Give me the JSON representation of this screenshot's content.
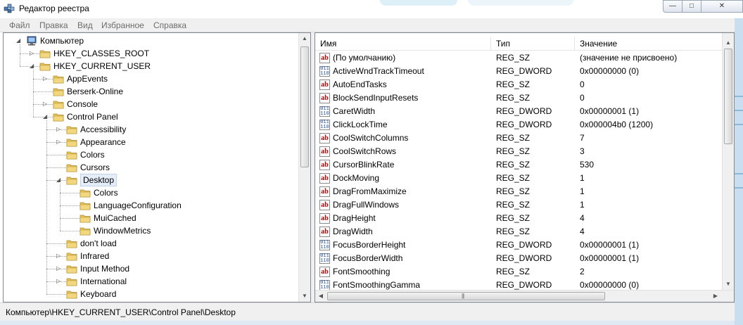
{
  "window": {
    "title": "Редактор реестра",
    "minimize_label": "—",
    "maximize_label": "□",
    "close_label": "✕"
  },
  "menu": [
    "Файл",
    "Правка",
    "Вид",
    "Избранное",
    "Справка"
  ],
  "tree": {
    "items": [
      {
        "label": "Компьютер",
        "level": 0,
        "expander": "collapse",
        "icon": "computer-icon"
      },
      {
        "label": "HKEY_CLASSES_ROOT",
        "level": 1,
        "expander": "expand"
      },
      {
        "label": "HKEY_CURRENT_USER",
        "level": 1,
        "expander": "collapse"
      },
      {
        "label": "AppEvents",
        "level": 2,
        "expander": "expand"
      },
      {
        "label": "Berserk-Online",
        "level": 2,
        "expander": "none"
      },
      {
        "label": "Console",
        "level": 2,
        "expander": "expand"
      },
      {
        "label": "Control Panel",
        "level": 2,
        "expander": "collapse"
      },
      {
        "label": "Accessibility",
        "level": 3,
        "expander": "expand"
      },
      {
        "label": "Appearance",
        "level": 3,
        "expander": "expand"
      },
      {
        "label": "Colors",
        "level": 3,
        "expander": "none"
      },
      {
        "label": "Cursors",
        "level": 3,
        "expander": "none"
      },
      {
        "label": "Desktop",
        "level": 3,
        "expander": "collapse",
        "selected": true
      },
      {
        "label": "Colors",
        "level": 4,
        "expander": "none"
      },
      {
        "label": "LanguageConfiguration",
        "level": 4,
        "expander": "none"
      },
      {
        "label": "MuiCached",
        "level": 4,
        "expander": "none"
      },
      {
        "label": "WindowMetrics",
        "level": 4,
        "expander": "none"
      },
      {
        "label": "don't load",
        "level": 3,
        "expander": "none"
      },
      {
        "label": "Infrared",
        "level": 3,
        "expander": "expand"
      },
      {
        "label": "Input Method",
        "level": 3,
        "expander": "expand"
      },
      {
        "label": "International",
        "level": 3,
        "expander": "expand"
      },
      {
        "label": "Keyboard",
        "level": 3,
        "expander": "none"
      }
    ]
  },
  "list": {
    "columns": [
      "Имя",
      "Тип",
      "Значение"
    ],
    "rows": [
      {
        "name": "(По умолчанию)",
        "type": "REG_SZ",
        "value": "(значение не присвоено)",
        "icon": "string-value-icon"
      },
      {
        "name": "ActiveWndTrackTimeout",
        "type": "REG_DWORD",
        "value": "0x00000000 (0)",
        "icon": "binary-value-icon"
      },
      {
        "name": "AutoEndTasks",
        "type": "REG_SZ",
        "value": "0",
        "icon": "string-value-icon"
      },
      {
        "name": "BlockSendInputResets",
        "type": "REG_SZ",
        "value": "0",
        "icon": "string-value-icon"
      },
      {
        "name": "CaretWidth",
        "type": "REG_DWORD",
        "value": "0x00000001 (1)",
        "icon": "binary-value-icon"
      },
      {
        "name": "ClickLockTime",
        "type": "REG_DWORD",
        "value": "0x000004b0 (1200)",
        "icon": "binary-value-icon"
      },
      {
        "name": "CoolSwitchColumns",
        "type": "REG_SZ",
        "value": "7",
        "icon": "string-value-icon"
      },
      {
        "name": "CoolSwitchRows",
        "type": "REG_SZ",
        "value": "3",
        "icon": "string-value-icon"
      },
      {
        "name": "CursorBlinkRate",
        "type": "REG_SZ",
        "value": "530",
        "icon": "string-value-icon"
      },
      {
        "name": "DockMoving",
        "type": "REG_SZ",
        "value": "1",
        "icon": "string-value-icon"
      },
      {
        "name": "DragFromMaximize",
        "type": "REG_SZ",
        "value": "1",
        "icon": "string-value-icon"
      },
      {
        "name": "DragFullWindows",
        "type": "REG_SZ",
        "value": "1",
        "icon": "string-value-icon"
      },
      {
        "name": "DragHeight",
        "type": "REG_SZ",
        "value": "4",
        "icon": "string-value-icon"
      },
      {
        "name": "DragWidth",
        "type": "REG_SZ",
        "value": "4",
        "icon": "string-value-icon"
      },
      {
        "name": "FocusBorderHeight",
        "type": "REG_DWORD",
        "value": "0x00000001 (1)",
        "icon": "binary-value-icon"
      },
      {
        "name": "FocusBorderWidth",
        "type": "REG_DWORD",
        "value": "0x00000001 (1)",
        "icon": "binary-value-icon"
      },
      {
        "name": "FontSmoothing",
        "type": "REG_SZ",
        "value": "2",
        "icon": "string-value-icon"
      },
      {
        "name": "FontSmoothingGamma",
        "type": "REG_DWORD",
        "value": "0x00000000 (0)",
        "icon": "binary-value-icon"
      }
    ]
  },
  "status": {
    "path": "Компьютер\\HKEY_CURRENT_USER\\Control Panel\\Desktop"
  },
  "colors": {
    "folder": "#e8c25a",
    "selection": "#e5eef8",
    "string_icon": "#c00000",
    "dword_icon": "#1e4fa3"
  }
}
